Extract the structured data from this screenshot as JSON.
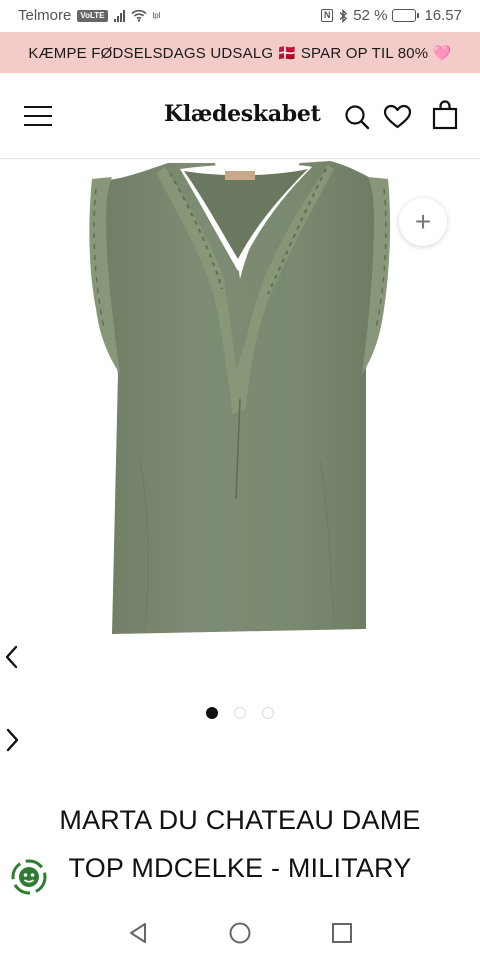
{
  "status_bar": {
    "carrier": "Telmore",
    "volte": "VoLTE",
    "data_indicator": "lpl",
    "nfc": "N",
    "battery_level": "52 %",
    "battery_fraction": 0.52,
    "time": "16.57"
  },
  "promo": {
    "text": "KÆMPE FØDSELSDAGS UDSALG 🇩🇰 SPAR OP TIL 80% 🩷",
    "background": "#f3cbc9"
  },
  "header": {
    "logo": "Klædeskabet",
    "icons": [
      "menu-icon",
      "search-icon",
      "heart-icon",
      "shopping-bag-icon"
    ]
  },
  "product": {
    "image_description_icon": "tank-top",
    "garment_color": "#7c8b70",
    "title": "MARTA DU CHATEAU DAME TOP MDCELKE - MILITARY",
    "title_line1": "MARTA DU CHATEAU DAME",
    "title_line2": "TOP MDCELKE - MILITARY"
  },
  "gallery": {
    "current_index": 1,
    "total": 3
  },
  "zoom_button": {
    "icon": "plus-icon"
  },
  "eco_badge": {
    "icon": "eco-badge-icon",
    "color": "#2e7d32"
  },
  "nav_bar": {
    "icons": [
      "back-icon",
      "home-icon",
      "recents-icon"
    ]
  }
}
